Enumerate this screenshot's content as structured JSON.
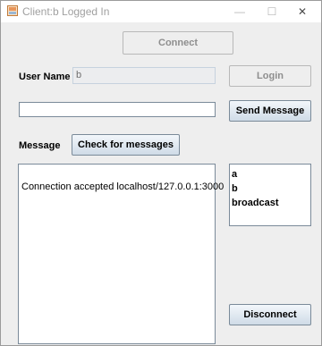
{
  "window": {
    "title": "Client:b Logged In",
    "controls": {
      "minimize": "—",
      "maximize": "☐",
      "close": "✕"
    }
  },
  "connect_button": "Connect",
  "login": {
    "label": "User Name",
    "value": "b",
    "button": "Login"
  },
  "send": {
    "input_value": "",
    "button": "Send Message"
  },
  "messages": {
    "label": "Message",
    "check_button": "Check for messages",
    "log": [
      "Connection accepted localhost/127.0.0.1:3000"
    ]
  },
  "users": [
    "a",
    "b",
    "broadcast"
  ],
  "disconnect_button": "Disconnect"
}
